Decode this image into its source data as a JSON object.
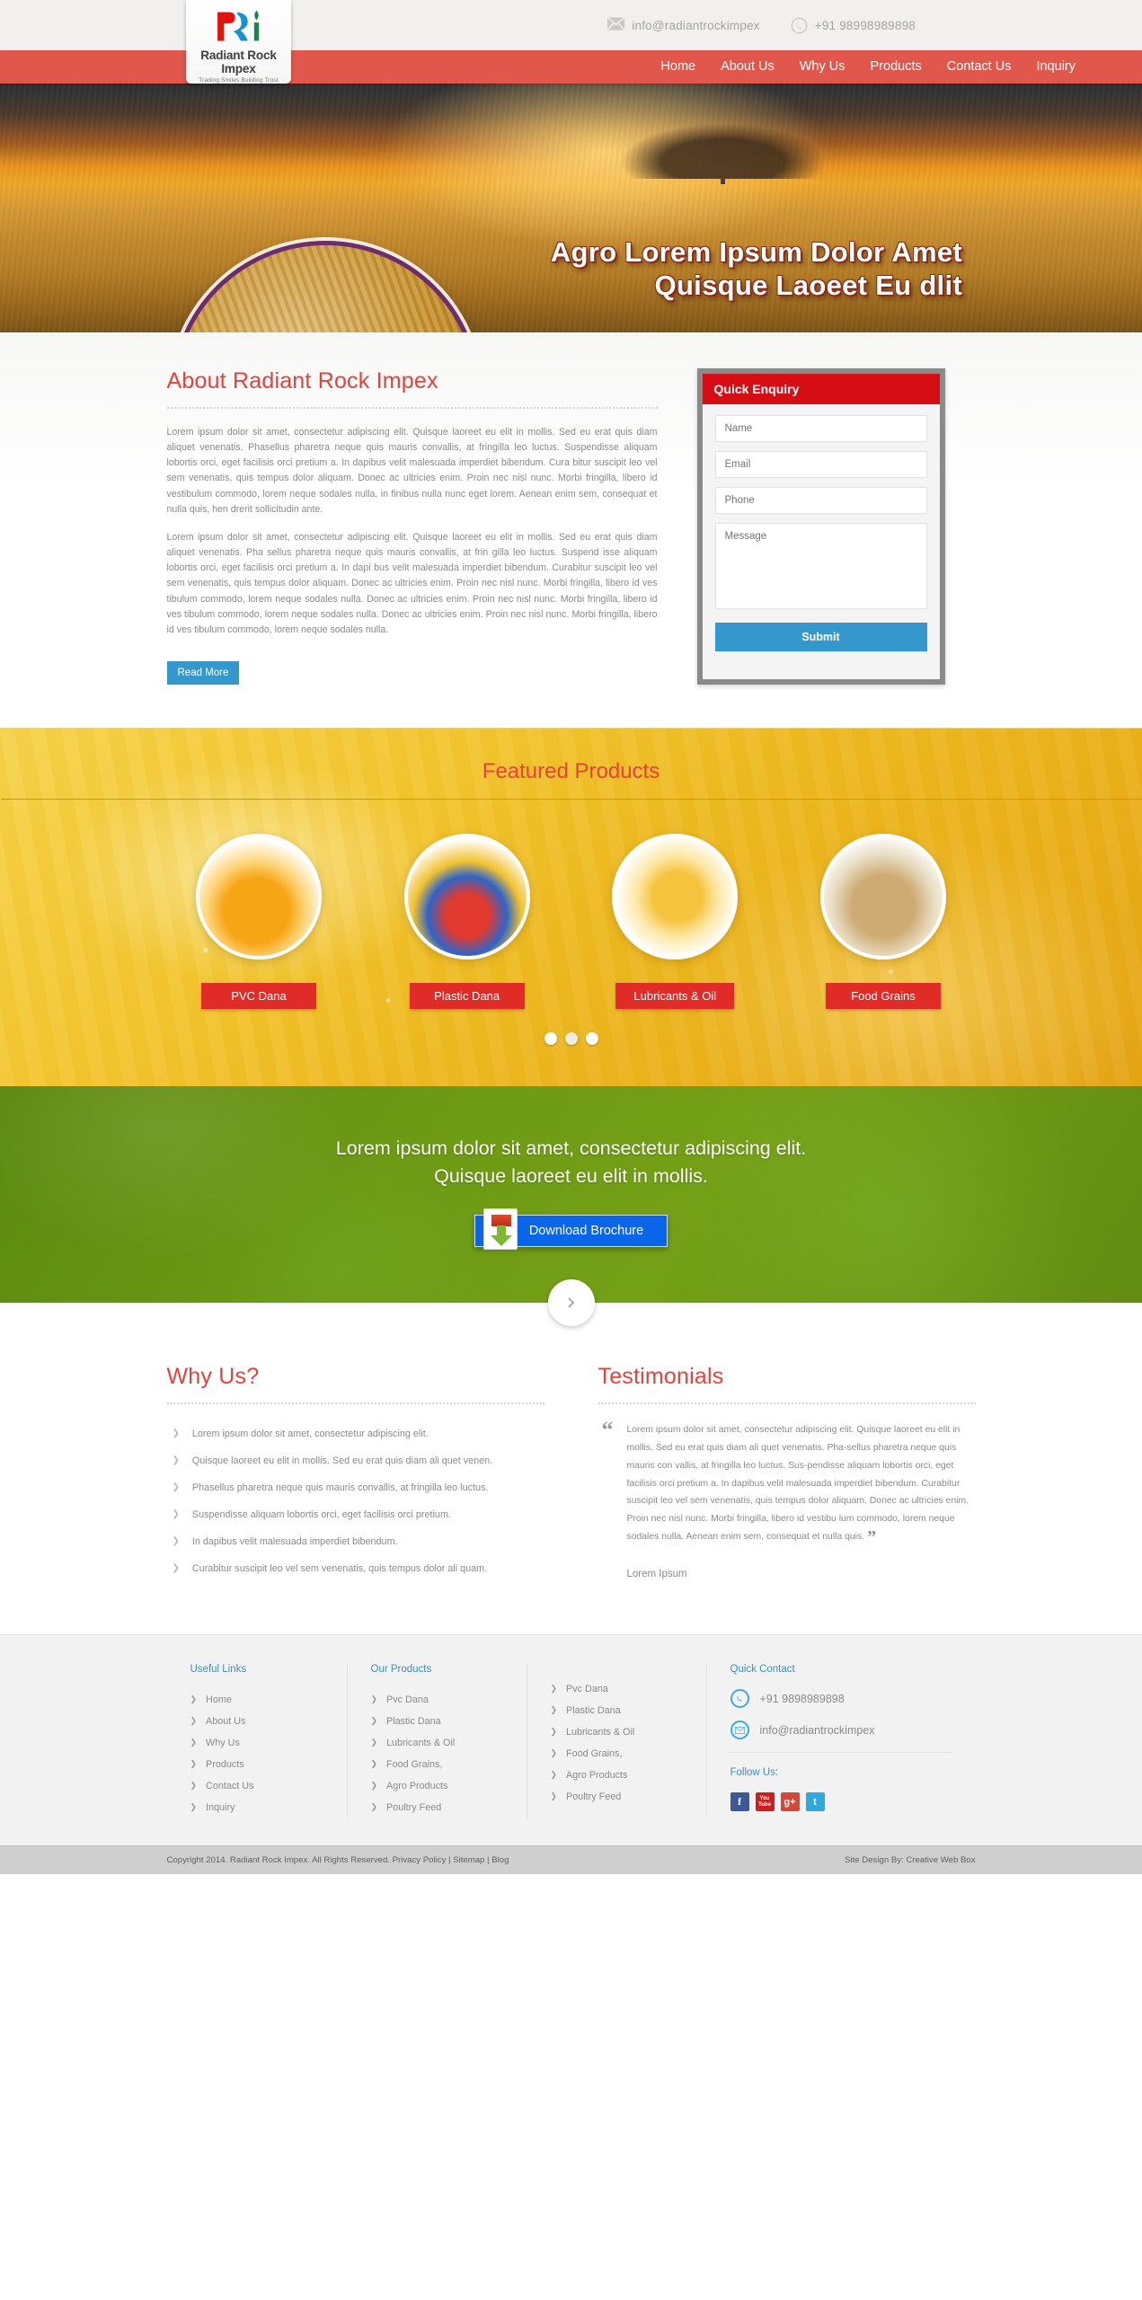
{
  "topbar": {
    "email": "info@radiantrockimpex",
    "phone": "+91 98998989898",
    "mail_icon": "mail-icon",
    "phone_icon": "phone-icon"
  },
  "logo": {
    "name": "Radiant Rock Impex",
    "tagline": "Trading Smiles Building Trust",
    "mark": "RRi"
  },
  "nav": {
    "items": [
      {
        "label": "Home"
      },
      {
        "label": "About Us"
      },
      {
        "label": "Why Us"
      },
      {
        "label": "Products"
      },
      {
        "label": "Contact Us"
      },
      {
        "label": "Inquiry"
      }
    ]
  },
  "hero": {
    "title_line1": "Agro Lorem Ipsum Dolor Amet",
    "title_line2": "Quisque Laoeet Eu dlit"
  },
  "about": {
    "title": "About Radiant Rock Impex",
    "paragraph1": "Lorem ipsum dolor sit amet, consectetur adipiscing elit. Quisque laoreet eu elit in mollis. Sed eu erat quis diam aliquet venenatis. Phasellus pharetra neque quis mauris convallis, at fringilla leo luctus. Suspendisse aliquam lobortis orci, eget facilisis orci pretium a. In dapibus velit malesuada imperdiet bibendum. Cura bitur suscipit leo vel sem venenatis, quis tempus dolor aliquam. Donec ac ultricies enim. Proin nec nisl nunc. Morbi fringilla, libero id vestibulum commodo, lorem neque sodales nulla, in finibus nulla nunc eget lorem. Aenean enim sem, consequat et nulla quis, hen  drerit sollicitudin ante.",
    "paragraph2": "Lorem ipsum dolor sit amet, consectetur adipiscing elit. Quisque laoreet eu elit in mollis. Sed eu erat quis diam aliquet venenatis. Pha sellus pharetra neque quis mauris convallis, at frin gilla leo luctus. Suspend isse aliquam lobortis orci, eget facilisis orci pretium a. In dapi bus velit malesuada imperdiet bibendum. Curabitur suscipit leo vel sem venenatis, quis tempus dolor aliquam. Donec ac ultricies enim. Proin nec nisl nunc. Morbi fringilla, libero id ves tibulum commodo, lorem neque sodales nulla. Donec ac ultricies enim. Proin nec nisl nunc. Morbi fringilla, libero id ves tibulum commodo, lorem neque sodales nulla. Donec ac ultricies enim. Proin nec nisl nunc. Morbi fringilla, libero id ves tibulum commodo, lorem neque sodales nulla.",
    "read_more": "Read More"
  },
  "enquiry": {
    "heading": "Quick Enquiry",
    "name_placeholder": "Name",
    "email_placeholder": "Email",
    "phone_placeholder": "Phone",
    "message_placeholder": "Message",
    "submit_label": "Submit"
  },
  "featured": {
    "title": "Featured Products",
    "products": [
      {
        "label": "PVC Dana",
        "icon": "pvc-granules-icon"
      },
      {
        "label": "Plastic Dana",
        "icon": "plastic-granules-icon"
      },
      {
        "label": "Lubricants & Oil",
        "icon": "oil-pour-icon"
      },
      {
        "label": "Food Grains",
        "icon": "food-grains-icon"
      }
    ],
    "carousel_dots": 3,
    "active_dot": 2
  },
  "cta": {
    "line1": "Lorem ipsum dolor sit amet, consectetur adipiscing elit.",
    "line2": "Quisque laoreet eu elit in mollis.",
    "button_label": "Download Brochure",
    "button_icon": "pdf-download-icon",
    "scroll_icon": "chevron-right-icon"
  },
  "why_us": {
    "title": "Why Us?",
    "items": [
      "Lorem ipsum dolor sit amet, consectetur adipiscing elit.",
      "Quisque laoreet eu elit in mollis. Sed eu erat quis diam ali quet venen.",
      "Phasellus pharetra neque quis mauris convallis, at fringilla leo luctus.",
      "Suspendisse aliquam lobortis orci, eget facilisis orci pretium.",
      "In dapibus velit malesuada imperdiet bibendum.",
      "Curabitur suscipit leo vel sem venenatis, quis tempus dolor ali quam."
    ]
  },
  "testimonials": {
    "title": "Testimonials",
    "quote_open": "“",
    "quote_close": "”",
    "quote": "Lorem ipsum dolor sit amet, consectetur adipiscing elit. Quisque laoreet eu elit in mollis. Sed eu erat quis diam ali quet venenatis. Pha-sellus pharetra neque quis mauris con vallis, at fringilla leo luctus. Sus-pendisse aliquam lobortis orci, eget facilisis orci pretium a. In dapibus velit malesuada imperdiet bibendum. Curabitur suscipit leo vel sem venenatis, quis tempus dolor aliquam. Donec ac ultricies enim. Proin nec nisl nunc. Morbi fringilla, libero id vestibu lum commodo, lorem neque sodales nulla. Aenean enim sem, consequat et nulla quis.",
    "author": "Lorem Ipsum"
  },
  "footer": {
    "useful_links": {
      "heading": "Useful Links",
      "items": [
        "Home",
        "About Us",
        "Why Us",
        "Products",
        "Contact Us",
        "Inquiry"
      ]
    },
    "our_products": {
      "heading": "Our Products",
      "items": [
        "Pvc Dana",
        "Plastic Dana",
        "Lubricants & Oil",
        "Food Grains,",
        "Agro Products",
        "Poultry Feed"
      ]
    },
    "our_products_2": {
      "heading": "",
      "items": [
        "Pvc Dana",
        "Plastic Dana",
        "Lubricants & Oil",
        "Food Grains,",
        "Agro Products",
        "Poultry Feed"
      ]
    },
    "quick_contact": {
      "heading": "Quick Contact",
      "phone": "+91 9898989898",
      "email": "info@radiantrockimpex",
      "phone_icon": "phone-icon",
      "mail_icon": "mail-icon"
    },
    "follow_us": {
      "heading": "Follow Us:",
      "socials": [
        {
          "name": "facebook-icon",
          "glyph": "f"
        },
        {
          "name": "youtube-icon",
          "glyph": "You Tube"
        },
        {
          "name": "googleplus-icon",
          "glyph": "g+"
        },
        {
          "name": "twitter-icon",
          "glyph": "t"
        }
      ]
    }
  },
  "copyright": {
    "left": "Copyright 2014. Radiant Rock Impex. All Rights Reserved. Privacy Policy | Sitemap | Blog",
    "right": "Site Design By: Creative Web Box"
  },
  "colors": {
    "brand_red": "#e2574c",
    "heading_red": "#e8413a",
    "enquiry_red": "#d60d14",
    "accent_blue": "#3498cd",
    "footer_heading_blue": "#3f8fba",
    "cta_green": "#6d9a14"
  }
}
